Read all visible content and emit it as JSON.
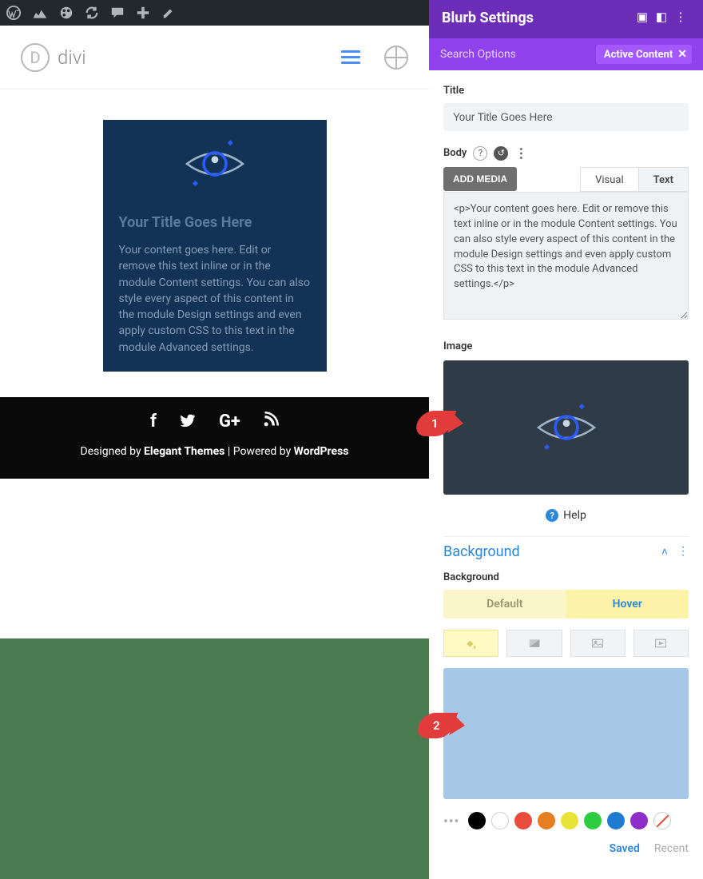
{
  "adminbar": {
    "pink_badge": "*"
  },
  "site": {
    "logo_letter": "D",
    "logo_text": "divi"
  },
  "blurb": {
    "title": "Your Title Goes Here",
    "body": "Your content goes here. Edit or remove this text inline or in the module Content settings. You can also style every aspect of this content in the module Design settings and even apply custom CSS to this text in the module Advanced settings."
  },
  "footer": {
    "designed_by": "Designed by ",
    "theme": "Elegant Themes",
    "sep": " | Powered by ",
    "platform": "WordPress"
  },
  "panel": {
    "title": "Blurb Settings",
    "search_placeholder": "Search Options",
    "active_filter": "Active Content",
    "fields": {
      "title_label": "Title",
      "title_value": "Your Title Goes Here",
      "body_label": "Body",
      "add_media": "ADD MEDIA",
      "tab_visual": "Visual",
      "tab_text": "Text",
      "body_code": "<p>Your content goes here. Edit or remove this text inline or in the module Content settings. You can also style every aspect of this content in the module Design settings and even apply custom CSS to this text in the module Advanced settings.</p>",
      "image_label": "Image",
      "help": "Help"
    },
    "background": {
      "section_title": "Background",
      "label": "Background",
      "tab_default": "Default",
      "tab_hover": "Hover",
      "preview_color": "#a7c7e7",
      "swatches": [
        "#000000",
        "#ffffff",
        "#e74c3c",
        "#e67e22",
        "#e8e337",
        "#2ecc40",
        "#1f7ad1",
        "#8e2ec9"
      ],
      "saved": "Saved",
      "recent": "Recent"
    }
  },
  "callouts": {
    "one": "1",
    "two": "2"
  }
}
